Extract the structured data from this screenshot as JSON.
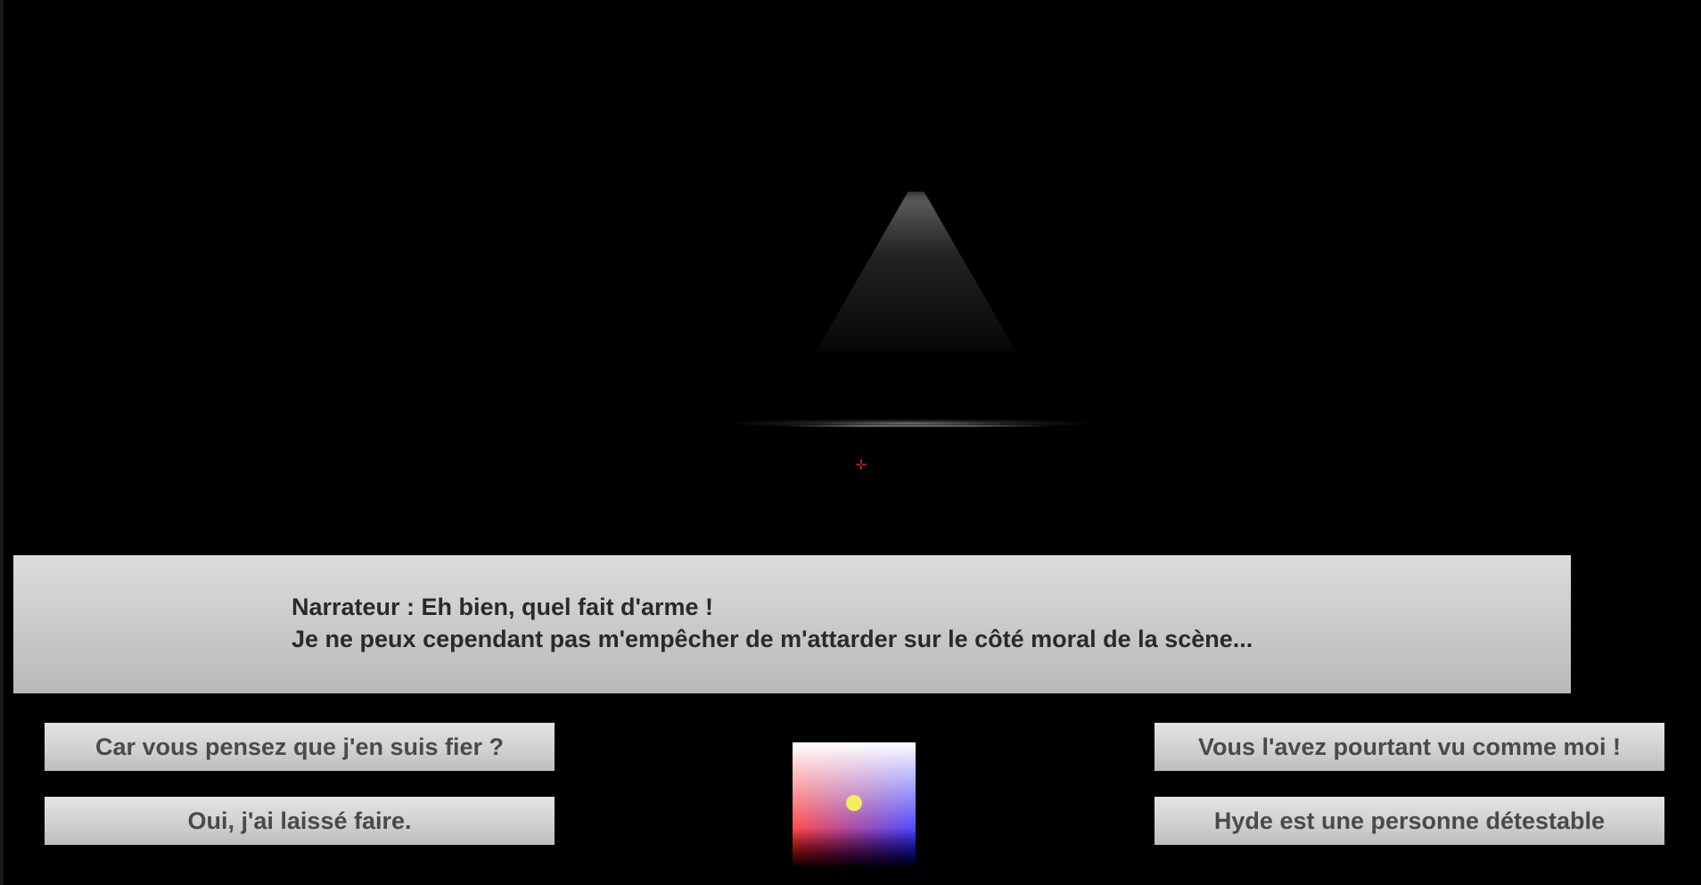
{
  "dialog": {
    "line1": "Narrateur : Eh bien, quel fait d'arme !",
    "line2": "Je ne peux cependant pas m'empêcher de m'attarder sur le côté moral de la scène..."
  },
  "choices": [
    {
      "label": "Car vous pensez que j'en suis fier ?"
    },
    {
      "label": "Oui, j'ai laissé faire."
    },
    {
      "label": "Vous l'avez pourtant vu comme moi !"
    },
    {
      "label": "Hyde est une personne détestable"
    }
  ],
  "crosshair": {
    "glyph": "✛",
    "color": "#c0202a"
  },
  "color_picker": {
    "top_color": "#ffffff",
    "left_color": "#ff0000",
    "right_color": "#0000ff",
    "knob_color": "#f2ef5a"
  }
}
